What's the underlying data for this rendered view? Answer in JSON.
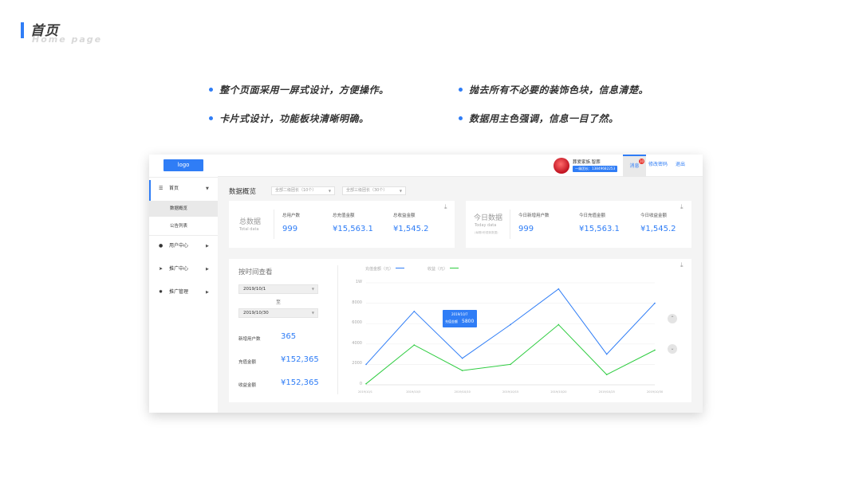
{
  "slide": {
    "title": "首页",
    "subtitle": "Home page",
    "accent": "#2f7df6",
    "bullets": [
      "整个页面采用一屏式设计，方便操作。",
      "抛去所有不必要的装饰色块，信息清楚。",
      "卡片式设计，功能板块清晰明确。",
      "数据用主色强调，信息一目了然。"
    ]
  },
  "sidebar": {
    "logo": "logo",
    "home": {
      "label": "首页",
      "icon": "list-icon"
    },
    "sub_items": [
      "数据概览",
      "公告列表"
    ],
    "items": [
      {
        "label": "用户中心",
        "icon": "user-icon"
      },
      {
        "label": "推广中心",
        "icon": "send-icon"
      },
      {
        "label": "推广管理",
        "icon": "gear-icon"
      }
    ]
  },
  "topbar": {
    "user_name": "葬爱家族.智葬",
    "user_tag": "一级团长：13849682253",
    "badge_count": "10",
    "message": "消息",
    "change_password": "修改密码",
    "logout": "退出"
  },
  "overview": {
    "title": "数据概览",
    "filter1": "全部二级团长（10个）",
    "filter2": "全部三级团长（30个）"
  },
  "total_card": {
    "title_cn": "总数据",
    "title_en": "Total data",
    "stats": [
      {
        "label": "总用户数",
        "value": "999"
      },
      {
        "label": "总充值金额",
        "value": "¥15,563.1"
      },
      {
        "label": "总收益金额",
        "value": "¥1,545.2"
      }
    ]
  },
  "today_card": {
    "title_cn": "今日数据",
    "title_en": "Today data",
    "note": "(每隔5秒更新数据)",
    "stats": [
      {
        "label": "今日新增用户数",
        "value": "999"
      },
      {
        "label": "今日充值金额",
        "value": "¥15,563.1"
      },
      {
        "label": "今日收益金额",
        "value": "¥1,545.2"
      }
    ]
  },
  "time_panel": {
    "title": "按时间查看",
    "start_date": "2019/10/1",
    "to": "至",
    "end_date": "2019/10/30",
    "kpis": [
      {
        "label": "新增用户数",
        "value": "365"
      },
      {
        "label": "充值金额",
        "value": "¥152,365"
      },
      {
        "label": "收益金额",
        "value": "¥152,365"
      }
    ]
  },
  "tooltip": {
    "date": "2019/10/7",
    "label": "充值金额",
    "value": "5800"
  },
  "chart_data": {
    "type": "line",
    "x": [
      "2019/10/1",
      "2019/10/3",
      "2019/10/10",
      "2019/10/15",
      "2019/10/20",
      "2019/10/25",
      "2019/10/30"
    ],
    "y_ticks": [
      "0",
      "2000",
      "4000",
      "6000",
      "8000",
      "1W"
    ],
    "ylim": [
      0,
      10000
    ],
    "grid": true,
    "legend_position": "top-left",
    "series": [
      {
        "name": "充值金额（元）",
        "color": "#2f7df6",
        "values": [
          2000,
          7200,
          2600,
          5900,
          9400,
          3000,
          8000
        ]
      },
      {
        "name": "收益（元）",
        "color": "#2ecc40",
        "values": [
          100,
          3900,
          1400,
          2000,
          5900,
          1000,
          3400
        ]
      }
    ]
  }
}
